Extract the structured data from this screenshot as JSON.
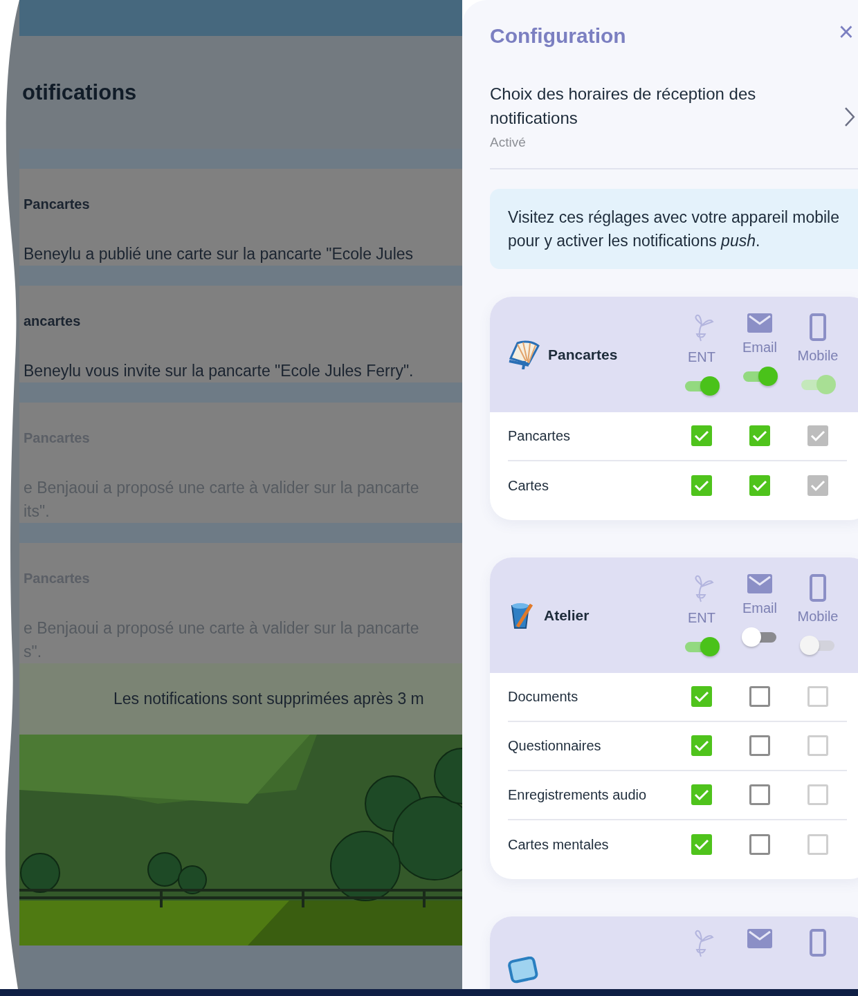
{
  "background": {
    "heading": "otifications",
    "notifications": [
      {
        "source": "Pancartes",
        "lines": [
          "Beneylu a publié une carte sur la pancarte \"Ecole Jules"
        ],
        "read": false
      },
      {
        "source": "ancartes",
        "lines": [
          "Beneylu vous invite sur la pancarte \"Ecole Jules Ferry\"."
        ],
        "read": false
      },
      {
        "source": "Pancartes",
        "lines": [
          "e Benjaoui a proposé une carte à valider sur la pancarte",
          "its\"."
        ],
        "read": true
      },
      {
        "source": "Pancartes",
        "lines": [
          "e Benjaoui a proposé une carte à valider sur la pancarte",
          "s\"."
        ],
        "read": true
      }
    ],
    "footer": "Les notifications sont supprimées après 3 m"
  },
  "panel": {
    "title": "Configuration",
    "close": "×",
    "schedule": {
      "title": "Choix des horaires de réception des notifications",
      "status": "Activé"
    },
    "info": "Visitez ces réglages avec votre appareil mobile pour y activer les notifications *push*.",
    "channels": [
      {
        "kind": "ent"
      },
      {
        "kind": "email"
      },
      {
        "kind": "mobile"
      }
    ],
    "apps": [
      {
        "name": "Pancartes",
        "toggles": [
          {
            "label": "ENT",
            "on": true,
            "disabled": false
          },
          {
            "label": "Email",
            "on": true,
            "disabled": false
          },
          {
            "label": "Mobile",
            "on": true,
            "disabled": true
          }
        ],
        "items": [
          {
            "label": "Pancartes",
            "checks": [
              {
                "checked": true,
                "disabled": false
              },
              {
                "checked": true,
                "disabled": false
              },
              {
                "checked": true,
                "disabled": true
              }
            ]
          },
          {
            "label": "Cartes",
            "checks": [
              {
                "checked": true,
                "disabled": false
              },
              {
                "checked": true,
                "disabled": false
              },
              {
                "checked": true,
                "disabled": true
              }
            ]
          }
        ]
      },
      {
        "name": "Atelier",
        "toggles": [
          {
            "label": "ENT",
            "on": true,
            "disabled": false
          },
          {
            "label": "Email",
            "on": false,
            "disabled": false
          },
          {
            "label": "Mobile",
            "on": false,
            "disabled": true
          }
        ],
        "items": [
          {
            "label": "Documents",
            "checks": [
              {
                "checked": true,
                "disabled": false
              },
              {
                "checked": false,
                "disabled": false
              },
              {
                "checked": false,
                "disabled": true
              }
            ]
          },
          {
            "label": "Questionnaires",
            "checks": [
              {
                "checked": true,
                "disabled": false
              },
              {
                "checked": false,
                "disabled": false
              },
              {
                "checked": false,
                "disabled": true
              }
            ]
          },
          {
            "label": "Enregistrements audio",
            "checks": [
              {
                "checked": true,
                "disabled": false
              },
              {
                "checked": false,
                "disabled": false
              },
              {
                "checked": false,
                "disabled": true
              }
            ]
          },
          {
            "label": "Cartes mentales",
            "checks": [
              {
                "checked": true,
                "disabled": false
              },
              {
                "checked": false,
                "disabled": false
              },
              {
                "checked": false,
                "disabled": true
              }
            ]
          }
        ]
      },
      {
        "partial": true
      }
    ]
  }
}
